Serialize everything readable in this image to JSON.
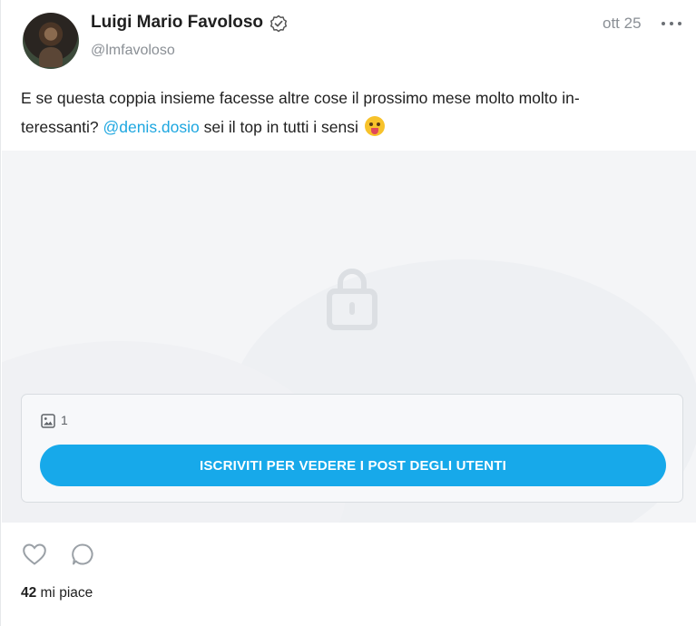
{
  "author": {
    "name": "Luigi Mario Favoloso",
    "handle": "@lmfavoloso",
    "avatar": "avatar"
  },
  "post": {
    "date": "ott 25",
    "text_line1": "E se questa coppia insieme facesse altre cose il prossimo mese molto molto in-",
    "text_line2_before": "teressanti? ",
    "mention": "@denis.dosio",
    "text_line2_after": " sei il top in tutti i sensi ",
    "emoji": "tongue-face-emoji"
  },
  "media": {
    "lock_icon": "lock-icon",
    "image_icon": "image-icon",
    "image_count": "1",
    "subscribe_label": "ISCRIVITI PER VEDERE I POST DEGLI UTENTI"
  },
  "actions": {
    "likes_count": "42",
    "likes_label": " mi piace"
  },
  "colors": {
    "accent": "#17a9ea",
    "mention": "#1ea7e0",
    "muted": "#8a8f95"
  }
}
